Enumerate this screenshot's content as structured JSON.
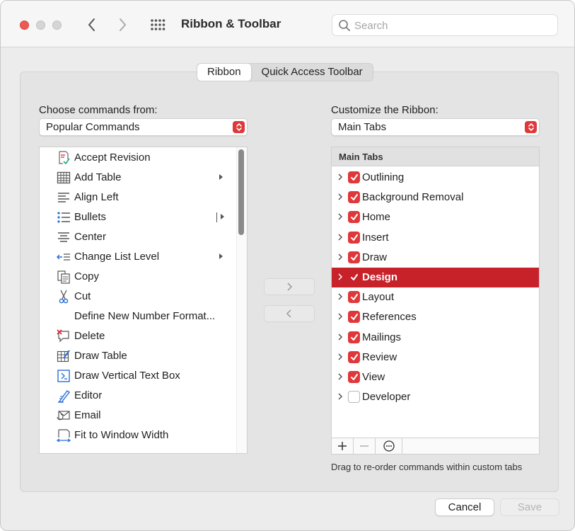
{
  "window": {
    "title": "Ribbon & Toolbar",
    "search_placeholder": "Search"
  },
  "tabs": [
    {
      "label": "Ribbon",
      "active": true
    },
    {
      "label": "Quick Access Toolbar",
      "active": false
    }
  ],
  "left": {
    "label": "Choose commands from:",
    "select_value": "Popular Commands",
    "commands": [
      {
        "label": "Accept Revision",
        "icon": "accept-revision-icon",
        "submenu": false
      },
      {
        "label": "Add Table",
        "icon": "table-icon",
        "submenu": true
      },
      {
        "label": "Align Left",
        "icon": "align-left-icon",
        "submenu": false
      },
      {
        "label": "Bullets",
        "icon": "bullets-icon",
        "submenu": "split"
      },
      {
        "label": "Center",
        "icon": "align-center-icon",
        "submenu": false
      },
      {
        "label": "Change List Level",
        "icon": "list-level-icon",
        "submenu": true
      },
      {
        "label": "Copy",
        "icon": "copy-icon",
        "submenu": false
      },
      {
        "label": "Cut",
        "icon": "scissors-icon",
        "submenu": false
      },
      {
        "label": "Define New Number Format...",
        "icon": "",
        "submenu": false
      },
      {
        "label": "Delete",
        "icon": "delete-comment-icon",
        "submenu": false
      },
      {
        "label": "Draw Table",
        "icon": "draw-table-icon",
        "submenu": false
      },
      {
        "label": "Draw Vertical Text Box",
        "icon": "text-box-icon",
        "submenu": false
      },
      {
        "label": "Editor",
        "icon": "editor-pen-icon",
        "submenu": false
      },
      {
        "label": "Email",
        "icon": "email-icon",
        "submenu": false
      },
      {
        "label": "Fit to Window Width",
        "icon": "fit-width-icon",
        "submenu": false
      }
    ]
  },
  "right": {
    "label": "Customize the Ribbon:",
    "select_value": "Main Tabs",
    "tree_header": "Main Tabs",
    "tabs": [
      {
        "label": "Outlining",
        "checked": true,
        "selected": false
      },
      {
        "label": "Background Removal",
        "checked": true,
        "selected": false
      },
      {
        "label": "Home",
        "checked": true,
        "selected": false
      },
      {
        "label": "Insert",
        "checked": true,
        "selected": false
      },
      {
        "label": "Draw",
        "checked": true,
        "selected": false
      },
      {
        "label": "Design",
        "checked": true,
        "selected": true
      },
      {
        "label": "Layout",
        "checked": true,
        "selected": false
      },
      {
        "label": "References",
        "checked": true,
        "selected": false
      },
      {
        "label": "Mailings",
        "checked": true,
        "selected": false
      },
      {
        "label": "Review",
        "checked": true,
        "selected": false
      },
      {
        "label": "View",
        "checked": true,
        "selected": false
      },
      {
        "label": "Developer",
        "checked": false,
        "selected": false
      }
    ],
    "hint": "Drag to re-order commands within custom tabs"
  },
  "buttons": {
    "cancel": "Cancel",
    "save": "Save"
  },
  "colors": {
    "accent": "#e0383a",
    "selection": "#c7212a"
  }
}
